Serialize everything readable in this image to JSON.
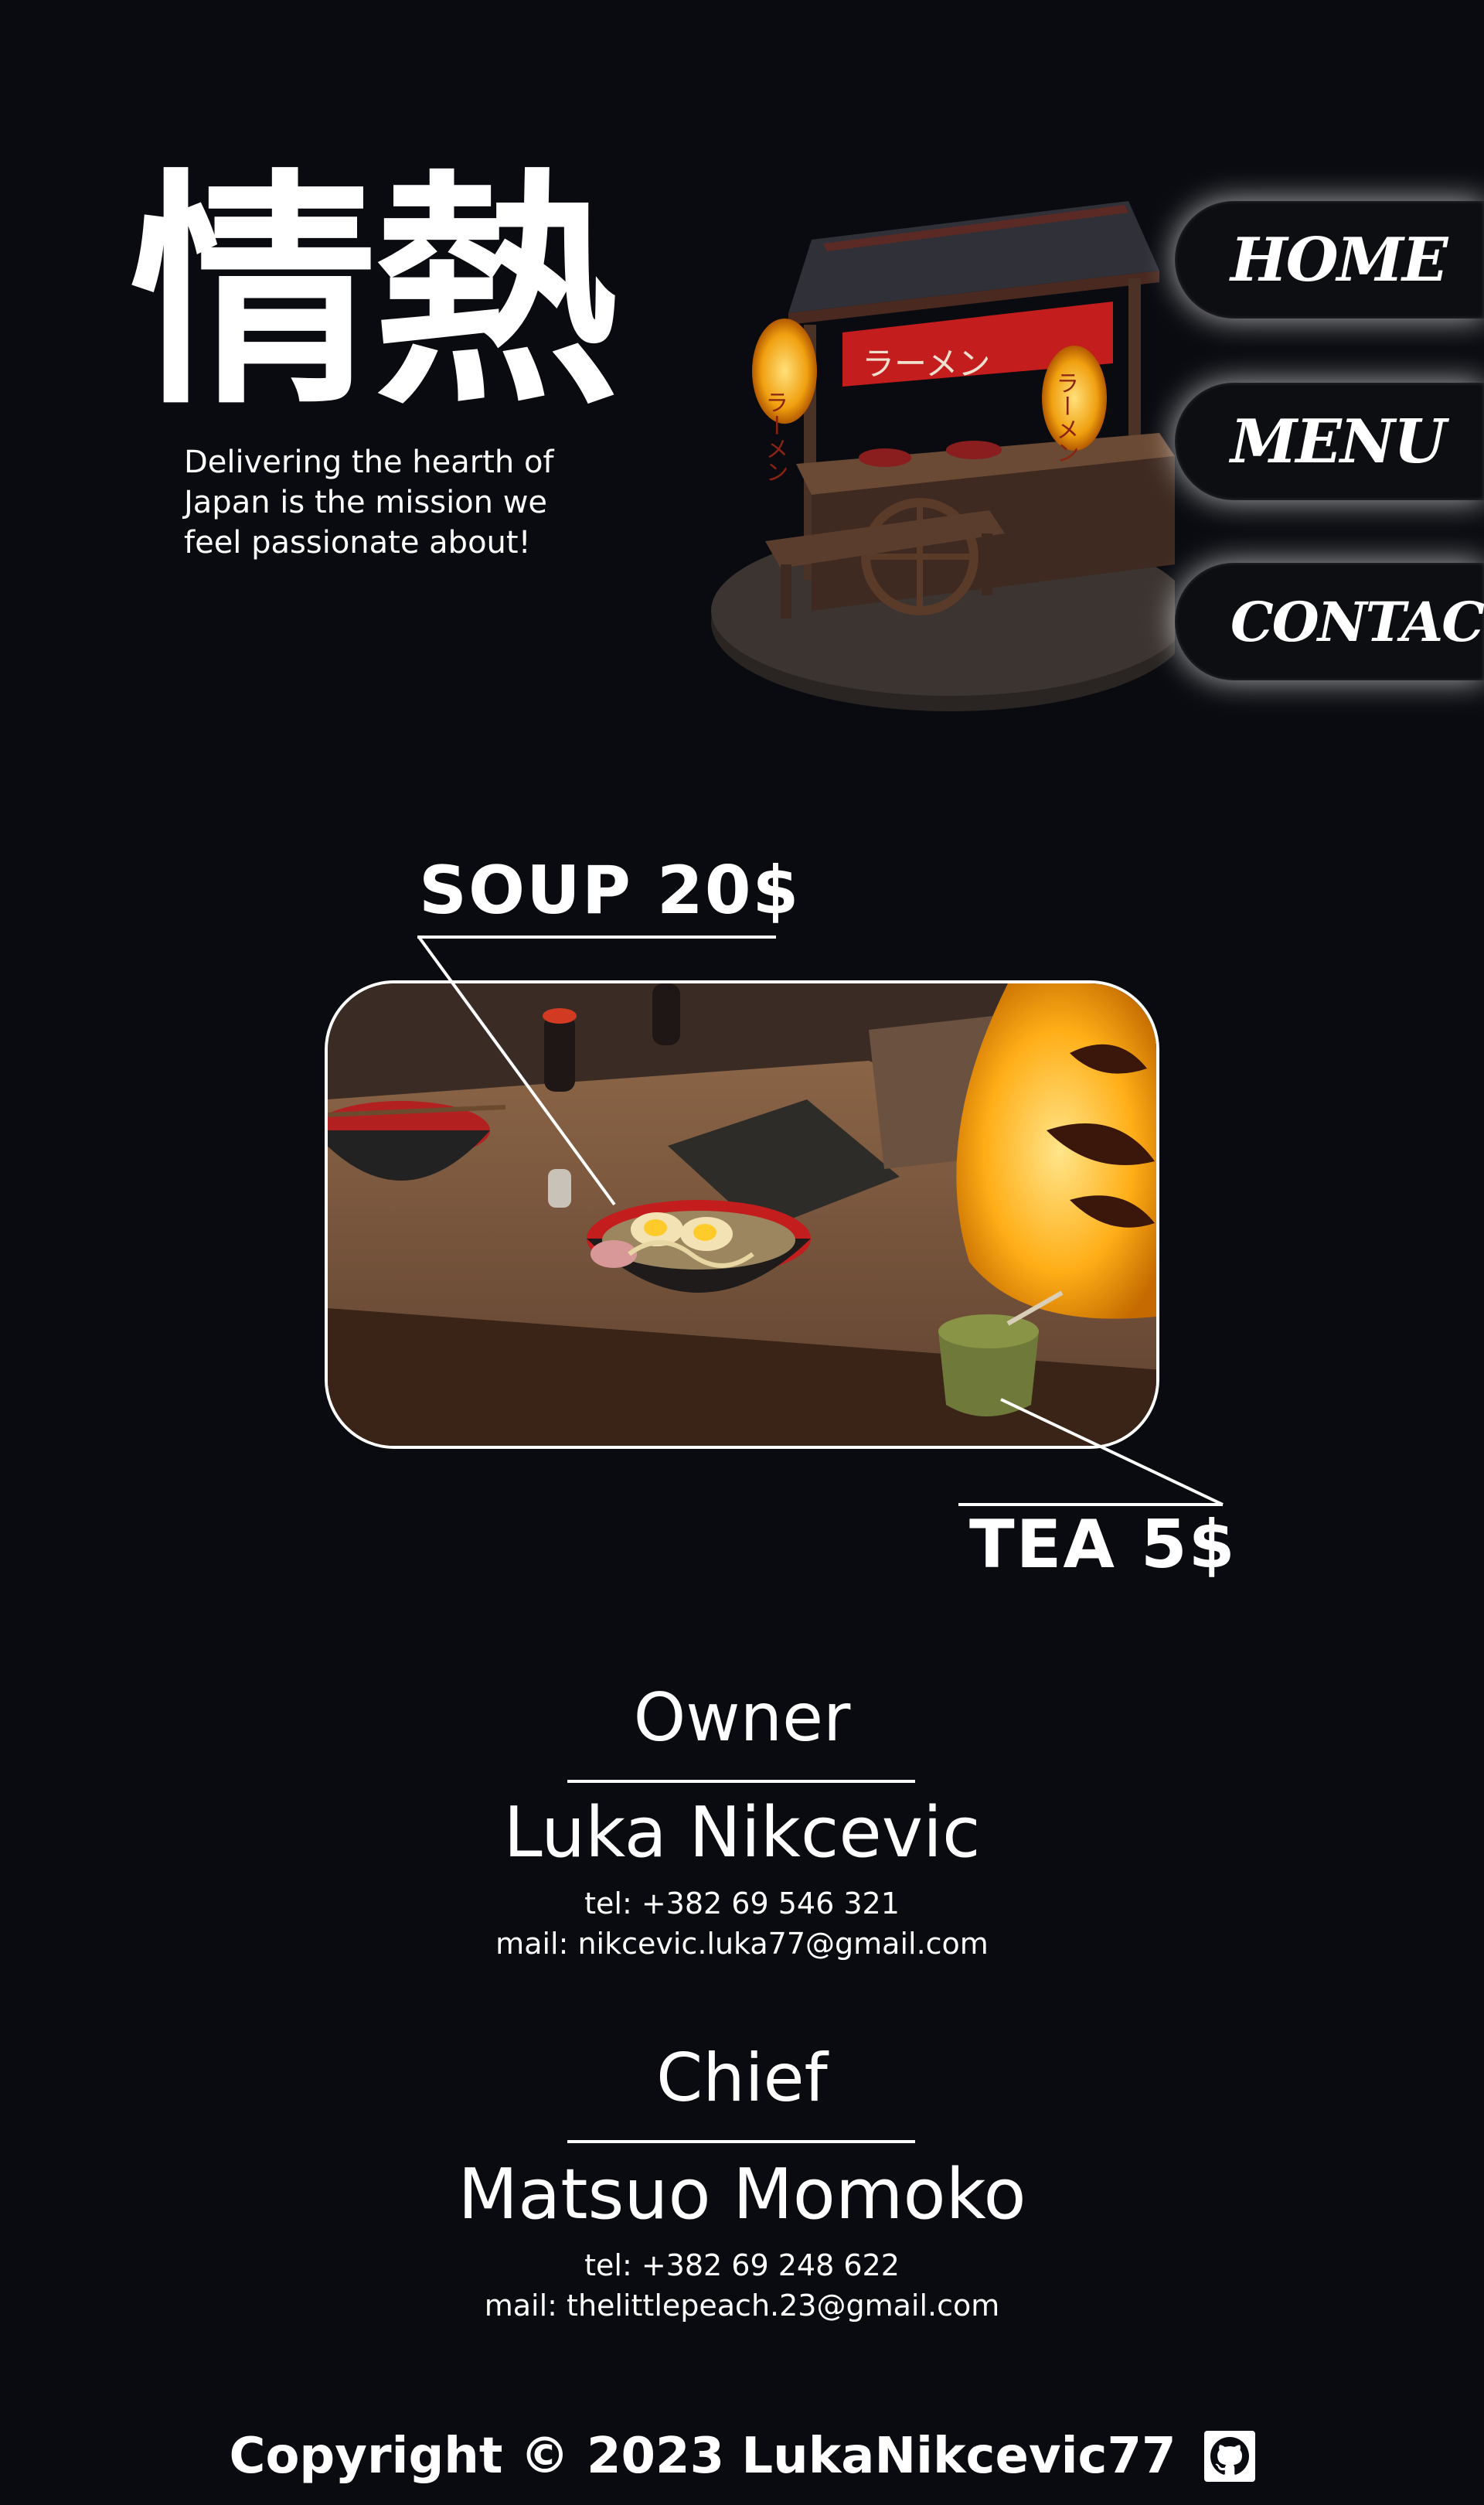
{
  "hero": {
    "kanji": "情熱",
    "tagline_lines": [
      "Delivering the hearth of",
      "Japan is the mission we",
      "feel passionate  about!"
    ]
  },
  "stall": {
    "banner_text": "ラーメン",
    "lantern_text": "ラーメン"
  },
  "nav": {
    "home": "HOME",
    "menu": "MENU",
    "contact": "CONTACT"
  },
  "menu": {
    "soup": "SOUP 20$",
    "tea": "TEA 5$"
  },
  "contacts": [
    {
      "role": "Owner",
      "name": "Luka Nikcevic",
      "tel": "tel: +382 69 546 321",
      "mail": "mail: nikcevic.luka77@gmail.com"
    },
    {
      "role": "Chief",
      "name": "Matsuo Momoko",
      "tel": "tel: +382 69 248 622",
      "mail": "mail: thelittlepeach.23@gmail.com"
    }
  ],
  "footer": {
    "copyright": "Copyright © 2023 LukaNikcevic77",
    "github_icon": "github-icon"
  },
  "colors": {
    "background": "#0a0b10",
    "accent_red": "#c41d1d",
    "lantern": "#ffb400"
  }
}
